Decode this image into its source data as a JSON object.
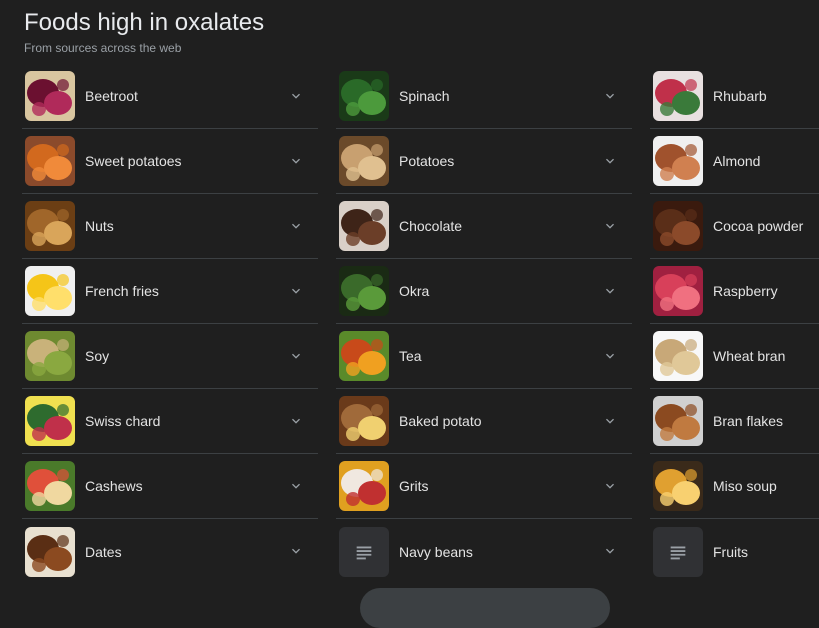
{
  "header": {
    "title": "Foods high in oxalates",
    "subtitle": "From sources across the web"
  },
  "columns": [
    {
      "items": [
        {
          "label": "Beetroot",
          "icon": "beetroot-image",
          "colors": [
            "#6b1030",
            "#b02a5a",
            "#d9c6a0"
          ]
        },
        {
          "label": "Sweet potatoes",
          "icon": "sweet-potatoes-image",
          "colors": [
            "#d2691e",
            "#f08a3a",
            "#8b4a2b"
          ]
        },
        {
          "label": "Nuts",
          "icon": "nuts-image",
          "colors": [
            "#a0662a",
            "#d9a55a",
            "#6b3e14"
          ]
        },
        {
          "label": "French fries",
          "icon": "french-fries-image",
          "colors": [
            "#f5c518",
            "#ffdf6b",
            "#f0f0f0"
          ]
        },
        {
          "label": "Soy",
          "icon": "soy-image",
          "colors": [
            "#c9b27a",
            "#8aa840",
            "#6e8a30"
          ]
        },
        {
          "label": "Swiss chard",
          "icon": "swiss-chard-image",
          "colors": [
            "#2e6b2e",
            "#c0304a",
            "#f0e050"
          ]
        },
        {
          "label": "Cashews",
          "icon": "cashews-image",
          "colors": [
            "#e0503a",
            "#f0d8a0",
            "#4a7a2a"
          ]
        },
        {
          "label": "Dates",
          "icon": "dates-image",
          "colors": [
            "#5a2e14",
            "#8b4a20",
            "#e8e0d0"
          ]
        }
      ]
    },
    {
      "items": [
        {
          "label": "Spinach",
          "icon": "spinach-image",
          "colors": [
            "#2a6a28",
            "#4c9a3c",
            "#1a3a18"
          ]
        },
        {
          "label": "Potatoes",
          "icon": "potatoes-image",
          "colors": [
            "#c8a070",
            "#e0c090",
            "#6b4a2a"
          ]
        },
        {
          "label": "Chocolate",
          "icon": "chocolate-image",
          "colors": [
            "#3e2418",
            "#6b3e28",
            "#d9d0c8"
          ]
        },
        {
          "label": "Okra",
          "icon": "okra-image",
          "colors": [
            "#3a6a2a",
            "#5a9a3a",
            "#1a2a14"
          ]
        },
        {
          "label": "Tea",
          "icon": "tea-image",
          "colors": [
            "#c84a1a",
            "#f0a020",
            "#5a8a2a"
          ]
        },
        {
          "label": "Baked potato",
          "icon": "baked-potato-image",
          "colors": [
            "#a06a3a",
            "#f0d070",
            "#6a3a1a"
          ]
        },
        {
          "label": "Grits",
          "icon": "grits-image",
          "colors": [
            "#f0e8e0",
            "#c03030",
            "#e0a020"
          ]
        },
        {
          "label": "Navy beans",
          "icon": "article-placeholder-icon",
          "placeholder": true
        }
      ]
    },
    {
      "items": [
        {
          "label": "Rhubarb",
          "icon": "rhubarb-image",
          "colors": [
            "#c0304a",
            "#3a7a3a",
            "#e8e0e0"
          ]
        },
        {
          "label": "Almond",
          "icon": "almond-image",
          "colors": [
            "#a0522d",
            "#d08050",
            "#f0f0f0"
          ]
        },
        {
          "label": "Cocoa powder",
          "icon": "cocoa-powder-image",
          "colors": [
            "#5a2e18",
            "#8b4a2a",
            "#3a1a0e"
          ]
        },
        {
          "label": "Raspberry",
          "icon": "raspberry-image",
          "colors": [
            "#d8405a",
            "#f07080",
            "#a02040"
          ]
        },
        {
          "label": "Wheat bran",
          "icon": "wheat-bran-image",
          "colors": [
            "#c8a878",
            "#e0c898",
            "#f8f8f8"
          ]
        },
        {
          "label": "Bran flakes",
          "icon": "bran-flakes-image",
          "colors": [
            "#8b4a20",
            "#c07a40",
            "#d0d0d0"
          ]
        },
        {
          "label": "Miso soup",
          "icon": "miso-soup-image",
          "colors": [
            "#e0a030",
            "#f8d070",
            "#3a2a1a"
          ]
        },
        {
          "label": "Fruits",
          "icon": "article-placeholder-icon",
          "placeholder": true
        }
      ]
    }
  ]
}
